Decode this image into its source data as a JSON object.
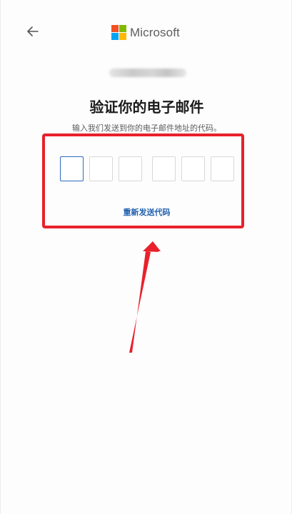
{
  "header": {
    "back_icon": "arrow-left-icon",
    "brand_name": "Microsoft",
    "logo_colors": [
      "#f25022",
      "#7fba00",
      "#00a4ef",
      "#ffb900"
    ]
  },
  "main": {
    "title": "验证你的电子邮件",
    "subtitle": "输入我们发送到你的电子邮件地址的代码。",
    "code_inputs": [
      "",
      "",
      "",
      "",
      "",
      ""
    ],
    "resend_label": "重新发送代码"
  },
  "annotation": {
    "highlight_color": "#e8212b",
    "arrow_icon": "red-arrow-icon"
  }
}
